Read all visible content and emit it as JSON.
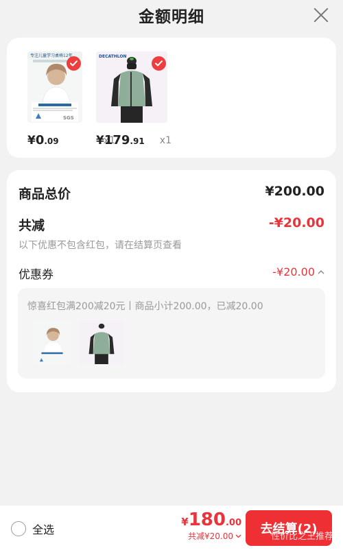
{
  "header": {
    "title": "金额明细"
  },
  "products": [
    {
      "price_symbol": "¥",
      "price_int": "0",
      "price_dec": ".09",
      "qty": "x1",
      "thumb_title": "专注儿童学习桌椅12年",
      "thumb_brand": "SGS"
    },
    {
      "price_symbol": "¥",
      "price_int": "179",
      "price_dec": ".91",
      "qty": "x1",
      "thumb_brand": "DECATHLON"
    }
  ],
  "summary": {
    "total_label": "商品总价",
    "total_value": "¥200.00",
    "discount_label": "共减",
    "discount_value": "-¥20.00",
    "discount_hint": "以下优惠不包含红包，请在结算页查看",
    "coupon_label": "优惠券",
    "coupon_value": "-¥20.00",
    "coupon_detail": "惊喜红包满200减20元丨商品小计200.00，已减20.00"
  },
  "bottom": {
    "select_all": "全选",
    "total_symbol": "¥",
    "total_int": "180",
    "total_dec": ".00",
    "saved": "共减¥20.00",
    "checkout": "去结算(2)",
    "watermark": "性价比之王推荐"
  },
  "colors": {
    "accent": "#ee2f34",
    "discount": "#e8343a"
  }
}
